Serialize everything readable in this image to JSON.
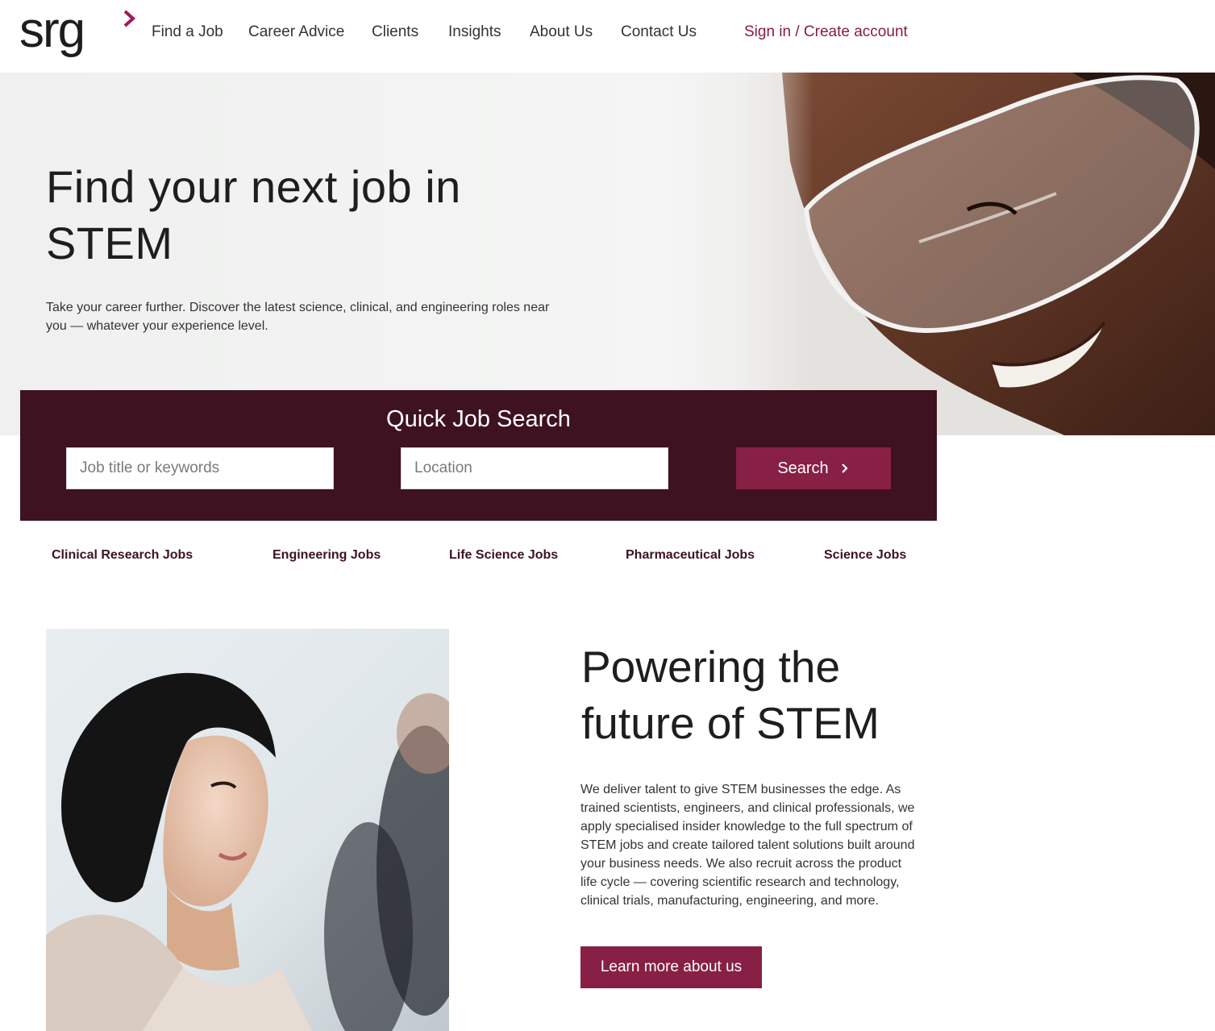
{
  "brand": {
    "logo_text": "srg",
    "accent_color": "#8a1a48",
    "dark_color": "#3e1220"
  },
  "nav": {
    "items": [
      {
        "label": "Find a Job"
      },
      {
        "label": "Career Advice"
      },
      {
        "label": "Clients"
      },
      {
        "label": "Insights"
      },
      {
        "label": "About Us"
      },
      {
        "label": "Contact Us"
      }
    ],
    "signin_label": "Sign in / Create account"
  },
  "hero": {
    "title": "Find your next job in STEM",
    "subtitle": "Take your career further. Discover the latest science, clinical, and engineering roles near you — whatever your experience level."
  },
  "search": {
    "title": "Quick Job Search",
    "keywords_placeholder": "Job title or keywords",
    "location_placeholder": "Location",
    "button_label": "Search",
    "button_icon": "chevron-right-icon"
  },
  "categories": [
    {
      "label": "Clinical Research Jobs"
    },
    {
      "label": "Engineering Jobs"
    },
    {
      "label": "Life Science Jobs"
    },
    {
      "label": "Pharmaceutical Jobs"
    },
    {
      "label": "Science Jobs"
    }
  ],
  "about": {
    "title": "Powering the future of STEM",
    "body": "We deliver talent to give STEM businesses the edge. As trained scientists, engineers, and clinical professionals, we apply specialised insider knowledge to the full spectrum of STEM jobs and create tailored talent solutions built around your business needs. We also recruit across the product life cycle — covering scientific research and technology, clinical trials, manufacturing, engineering, and more.",
    "button_label": "Learn more about us"
  }
}
